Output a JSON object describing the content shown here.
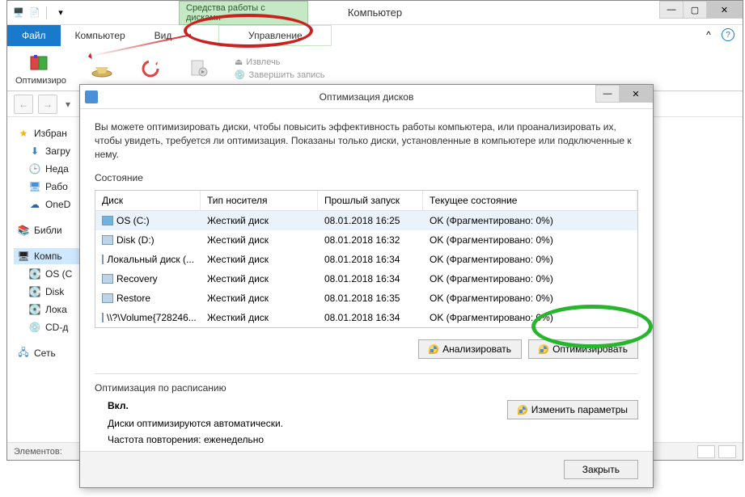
{
  "window": {
    "contextual_tab_header": "Средства работы с дисками",
    "title": "Компьютер",
    "tabs": {
      "file": "Файл",
      "computer": "Компьютер",
      "view": "Вид",
      "manage": "Управление"
    },
    "ribbon": {
      "optimize": "Оптимизиро",
      "eject": "Извлечь",
      "finish_burn": "Завершить запись"
    },
    "statusbar": {
      "elements": "Элементов:"
    }
  },
  "sidebar": {
    "favorites": "Избран",
    "downloads": "Загру",
    "recent": "Неда",
    "desktop": "Рабо",
    "onedrive": "OneD",
    "libraries": "Библи",
    "computer": "Компь",
    "os": "OS (C",
    "disk": "Disk",
    "local": "Лока",
    "cdrom": "CD-д",
    "network": "Сеть"
  },
  "dialog": {
    "title": "Оптимизация дисков",
    "description": "Вы можете оптимизировать диски, чтобы повысить эффективность работы  компьютера, или проанализировать их, чтобы увидеть, требуется ли оптимизация. Показаны только диски, установленные в компьютере или подключенные к нему.",
    "state_label": "Состояние",
    "columns": {
      "disk": "Диск",
      "media": "Тип носителя",
      "last": "Прошлый запуск",
      "status": "Текущее состояние"
    },
    "rows": [
      {
        "name": "OS (C:)",
        "media": "Жесткий диск",
        "last": "08.01.2018 16:25",
        "status": "OK (Фрагментировано: 0%)",
        "primary": true
      },
      {
        "name": "Disk (D:)",
        "media": "Жесткий диск",
        "last": "08.01.2018 16:32",
        "status": "OK (Фрагментировано: 0%)",
        "primary": false
      },
      {
        "name": "Локальный диск (...",
        "media": "Жесткий диск",
        "last": "08.01.2018 16:34",
        "status": "OK (Фрагментировано: 0%)",
        "primary": false
      },
      {
        "name": "Recovery",
        "media": "Жесткий диск",
        "last": "08.01.2018 16:34",
        "status": "OK (Фрагментировано: 0%)",
        "primary": false
      },
      {
        "name": "Restore",
        "media": "Жесткий диск",
        "last": "08.01.2018 16:35",
        "status": "OK (Фрагментировано: 0%)",
        "primary": false
      },
      {
        "name": "\\\\?\\Volume{728246...",
        "media": "Жесткий диск",
        "last": "08.01.2018 16:34",
        "status": "OK (Фрагментировано: 0%)",
        "primary": false
      }
    ],
    "analyze": "Анализировать",
    "optimize": "Оптимизировать",
    "schedule_label": "Оптимизация по расписанию",
    "schedule_on": "Вкл.",
    "schedule_auto": "Диски оптимизируются автоматически.",
    "schedule_freq": "Частота повторения: еженедельно",
    "change_settings": "Изменить параметры",
    "close": "Закрыть"
  }
}
